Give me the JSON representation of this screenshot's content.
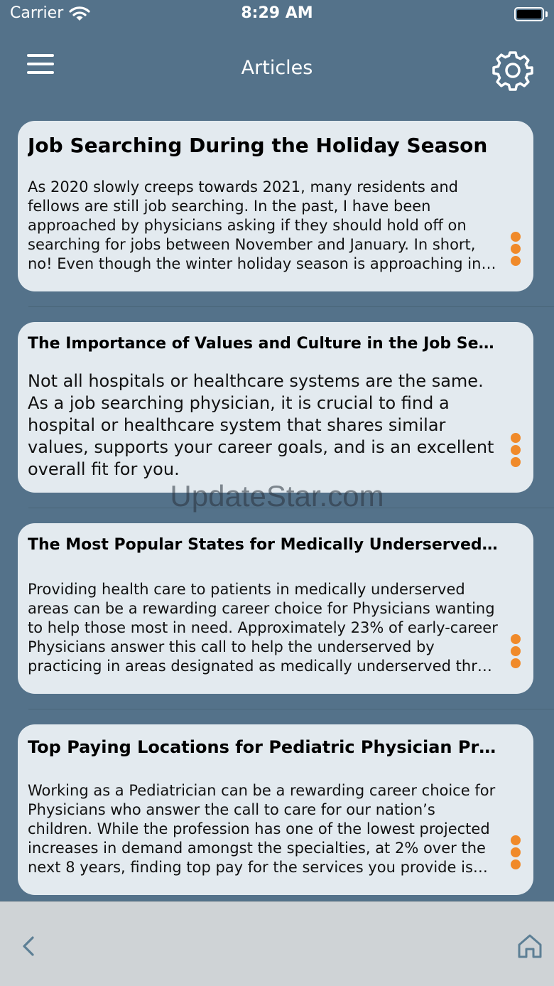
{
  "status_bar": {
    "carrier": "Carrier",
    "time": "8:29 AM",
    "wifi_icon": "wifi-icon",
    "battery_icon": "battery-icon"
  },
  "nav": {
    "title": "Articles",
    "menu_icon": "hamburger-menu-icon",
    "settings_icon": "gear-icon"
  },
  "articles": [
    {
      "title": "Job Searching During the Holiday Season",
      "body": "As 2020 slowly creeps towards 2021, many residents and fellows are still job searching. In the past, I have been approached by physicians asking if they should hold off on searching for jobs between November and January. In short, no! Even though the winter holiday season is approaching in…"
    },
    {
      "title": "The Importance of Values and Culture in the Job Search",
      "body": "Not all hospitals or healthcare systems are the same. As a job searching physician, it is crucial to find a hospital or healthcare system that shares similar values, supports your career goals, and is an excellent overall fit for you."
    },
    {
      "title": "The Most Popular States for Medically Underserved Phy…",
      "body": "Providing health care to patients in medically underserved areas can be a rewarding career choice for Physicians wanting to help those most in need. Approximately 23% of early-career Physicians answer this call to help the underserved by practicing in areas designated as medically underserved thr…"
    },
    {
      "title": "Top Paying Locations for Pediatric Physician Practice",
      "body": "Working as a Pediatrician can be a rewarding career choice for Physicians who answer the call to care for our nation’s children. While the profession has one of the lowest projected increases in demand amongst the specialties, at 2% over the next 8 years, finding top pay for the services you provide is…"
    }
  ],
  "watermark": "UpdateStar.com",
  "bottom_bar": {
    "back_icon": "chevron-left-icon",
    "home_icon": "home-icon"
  },
  "colors": {
    "background": "#54728a",
    "card": "#e3eaef",
    "accent_dots": "#f08a2a"
  }
}
